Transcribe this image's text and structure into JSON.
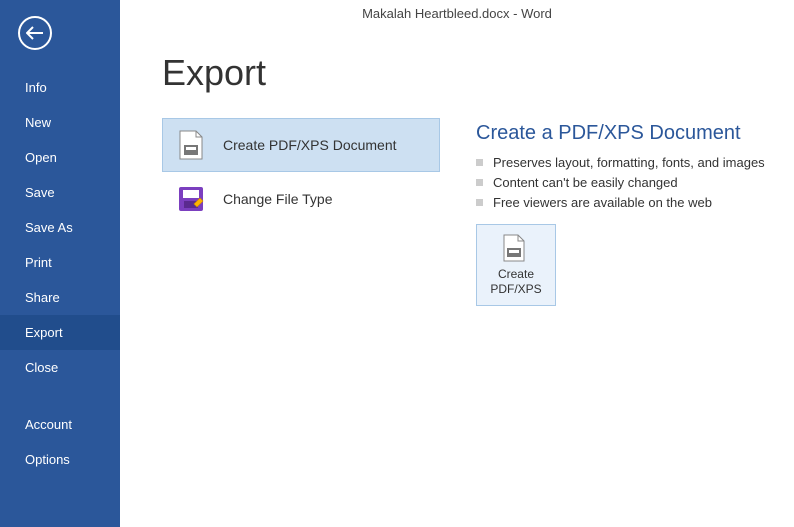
{
  "titlebar": "Makalah Heartbleed.docx - Word",
  "sidebar": {
    "items": [
      {
        "label": "Info"
      },
      {
        "label": "New"
      },
      {
        "label": "Open"
      },
      {
        "label": "Save"
      },
      {
        "label": "Save As"
      },
      {
        "label": "Print"
      },
      {
        "label": "Share"
      },
      {
        "label": "Export"
      },
      {
        "label": "Close"
      }
    ],
    "bottom": [
      {
        "label": "Account"
      },
      {
        "label": "Options"
      }
    ]
  },
  "page": {
    "title": "Export",
    "options": [
      {
        "label": "Create PDF/XPS Document"
      },
      {
        "label": "Change File Type"
      }
    ],
    "detail": {
      "title": "Create a PDF/XPS Document",
      "bullets": [
        "Preserves layout, formatting, fonts, and images",
        "Content can't be easily changed",
        "Free viewers are available on the web"
      ],
      "button": {
        "line1": "Create",
        "line2": "PDF/XPS"
      }
    }
  }
}
